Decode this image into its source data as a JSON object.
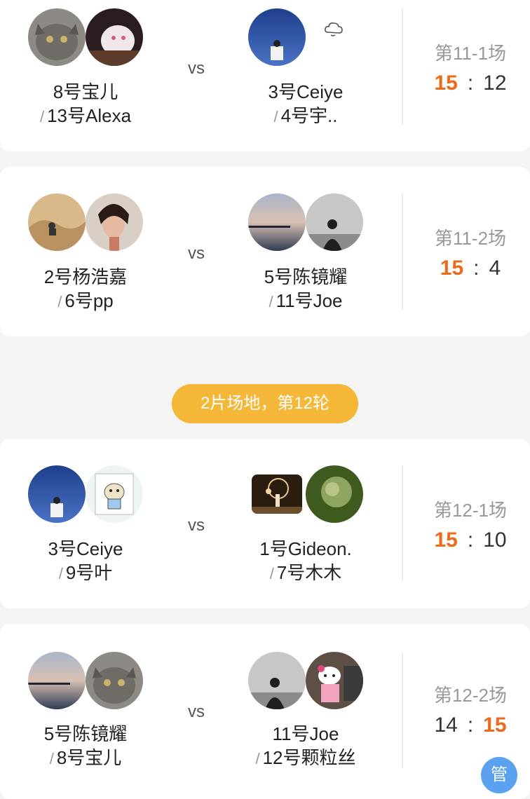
{
  "matches": [
    {
      "left_line1": "8号宝儿",
      "left_line2": "13号Alexa",
      "vs": "vs",
      "right_line1": "3号Ceiye",
      "right_line2": "4号宇..",
      "round": "第11-1场",
      "score_left": "15",
      "score_right": "12",
      "winner": "left"
    },
    {
      "left_line1": "2号杨浩嘉",
      "left_line2": "6号pp",
      "vs": "vs",
      "right_line1": "5号陈镜耀",
      "right_line2": "11号Joe",
      "round": "第11-2场",
      "score_left": "15",
      "score_right": "4",
      "winner": "left"
    },
    {
      "left_line1": "3号Ceiye",
      "left_line2": "9号叶",
      "vs": "vs",
      "right_line1": "1号Gideon.",
      "right_line2": "7号木木",
      "round": "第12-1场",
      "score_left": "15",
      "score_right": "10",
      "winner": "left"
    },
    {
      "left_line1": "5号陈镜耀",
      "left_line2": "8号宝儿",
      "vs": "vs",
      "right_line1": "11号Joe",
      "right_line2": "12号颗粒丝",
      "round": "第12-2场",
      "score_left": "14",
      "score_right": "15",
      "winner": "right"
    }
  ],
  "separator": "/",
  "colon": ":",
  "round_header": "2片场地，第12轮",
  "manage_label": "管",
  "colors": {
    "accent_orange": "#ee6a1b",
    "pill_yellow": "#f5b737",
    "manage_blue": "#5aa2f0"
  }
}
